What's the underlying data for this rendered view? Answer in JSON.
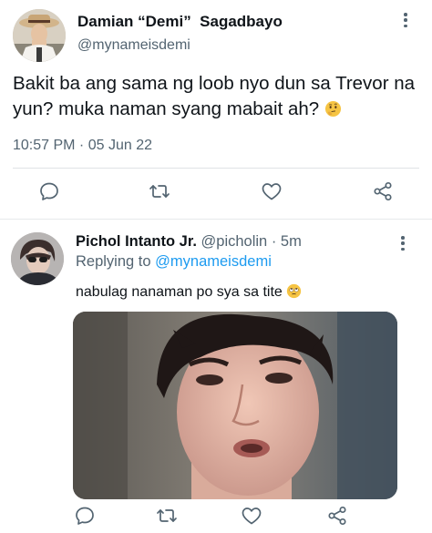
{
  "main_tweet": {
    "author_name": "Damian “Demi”  Sagadbayo",
    "author_handle": "@mynameisdemi",
    "text": "Bakit ba ang sama ng loob nyo dun sa Trevor na yun? muka naman syang mabait ah?",
    "emoji": "thinking-face",
    "timestamp": "10:57 PM · 05 Jun 22"
  },
  "reply_tweet": {
    "author_name": "Pichol Intanto Jr.",
    "author_handle": "@picholin",
    "separator": "·",
    "time_ago": "5m",
    "replying_prefix": "Replying to",
    "replying_handle": "@mynameisdemi",
    "text": "nabulag nanaman po sya sa tite",
    "emoji": "rolling-eyes-face"
  },
  "icons": {
    "reply": "reply-icon",
    "retweet": "retweet-icon",
    "like": "like-icon",
    "share": "share-icon",
    "more": "more-icon"
  },
  "colors": {
    "text_primary": "#0f1419",
    "text_secondary": "#536471",
    "mention": "#1d9bf0",
    "divider": "#dfe3e6"
  }
}
